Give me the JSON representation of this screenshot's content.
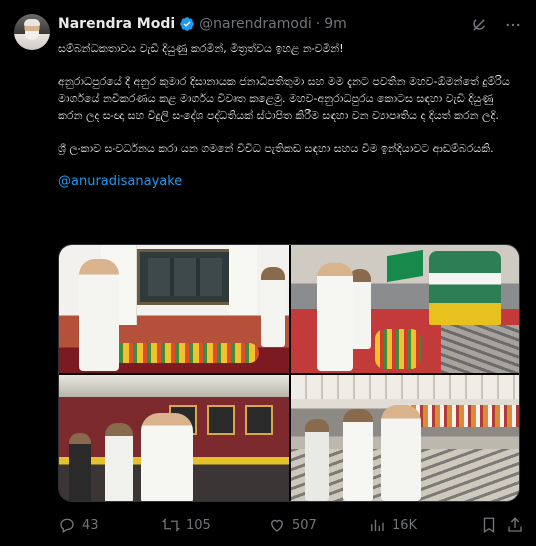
{
  "tweet": {
    "author_name": "Narendra Modi",
    "handle": "@narendramodi",
    "separator": "·",
    "time": "9m",
    "paragraphs": [
      "සම්බන්ධකතාවය වැඩි දියුණු කරමින්, මිත්‍රත්වය ඉහළ නංවමින්!",
      "අනුරාධපුරයේ දී අනුර කුමාර දිසානායක ජනාධිපතිතුමා සහ මම දැනට පවතින මහව-ඕමන්තේ දුම්රිය මාර්ගයේ නවීකරණය කළ මාර්ගය විවෘත කළෙමු. මහව-අනුරාධපුරය කොටස සඳහා වැඩි දියුණු කරන ලද සංඥා සහ විදුලි සංදේශ පද්ධතියක් ස්ථාපිත කිරීම සඳහා වන ව්‍යාපෘතිය ද දියත් කරන ලදි.",
      "ශ්‍රී ලංකාව සංවර්ධනය කරා යන ගමනේ විවිධ පැතිකඩ සඳහා සහය වීම ඉන්දියාවට ආඩම්බරයකි."
    ],
    "mention": "@anuradisanayake"
  },
  "media": {
    "photos": [
      "plaque-unveiling",
      "train-flag-off",
      "train-coach",
      "railway-platform"
    ]
  },
  "actions": {
    "replies": "43",
    "reposts": "105",
    "likes": "507",
    "views": "16K"
  },
  "colors": {
    "background": "#000000",
    "text": "#e7e9ea",
    "muted": "#71767b",
    "link": "#1d9bf0",
    "verified": "#1d9bf0"
  },
  "icons": [
    "grok-icon",
    "more-icon",
    "reply-icon",
    "repost-icon",
    "like-icon",
    "views-icon",
    "bookmark-icon",
    "share-icon"
  ]
}
